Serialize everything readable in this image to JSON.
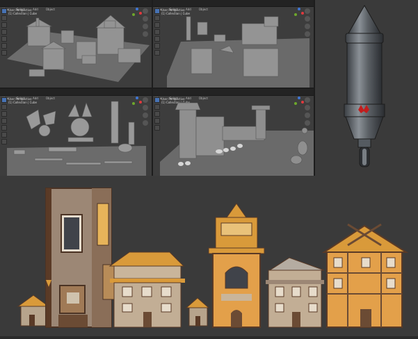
{
  "viewports": [
    {
      "id": "vp1",
      "menus": [
        "View",
        "Select",
        "Add",
        "Object"
      ],
      "overlay": [
        "User Perspective",
        "(1) Collection | Cube"
      ]
    },
    {
      "id": "vp2",
      "menus": [
        "View",
        "Select",
        "Add",
        "Object"
      ],
      "overlay": [
        "User Perspective",
        "(1) Collection | Cube"
      ]
    },
    {
      "id": "vp3",
      "menus": [
        "View",
        "Select",
        "Add",
        "Object"
      ],
      "overlay": [
        "User Perspective",
        "(1) Collection | Cube"
      ]
    },
    {
      "id": "vp4",
      "menus": [
        "View",
        "Select",
        "Add",
        "Object"
      ],
      "overlay": [
        "User Perspective",
        "(1) Collection | Cube"
      ]
    }
  ],
  "colors": {
    "viewport_bg": "#3d3d3d",
    "header_bg": "#232323",
    "active_tool": "#4772b3",
    "axis_x": "#e0393e",
    "axis_y": "#6ea82b",
    "axis_z": "#3f77d6",
    "rocket_emblem": "#c21d1d",
    "wood_light": "#d99a3a",
    "wood_dark": "#5a3a26",
    "plaster": "#b7a48c"
  },
  "icons": [
    "cursor-icon",
    "move-icon",
    "rotate-icon",
    "scale-icon",
    "transform-icon",
    "annotate-icon",
    "measure-icon",
    "zoom-icon",
    "pan-icon",
    "camera-icon",
    "grid-icon"
  ]
}
